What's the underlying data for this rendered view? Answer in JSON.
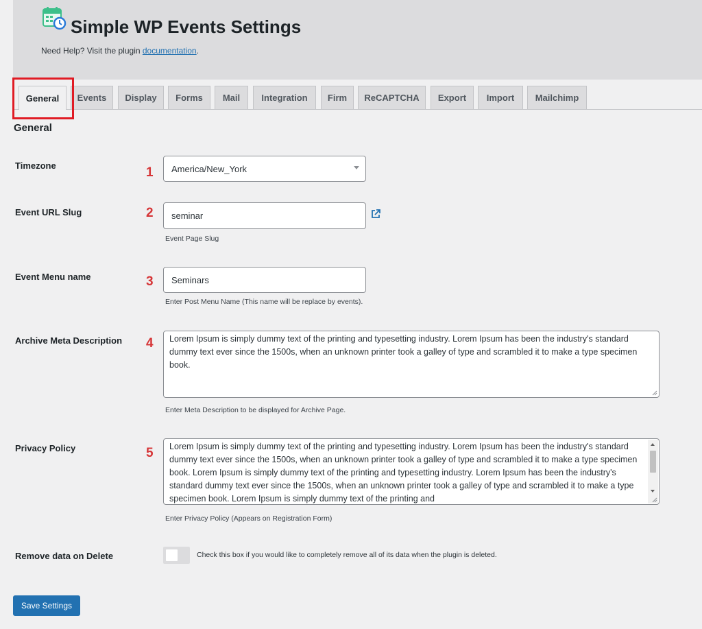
{
  "header": {
    "title": "Simple WP Events Settings",
    "help_prefix": "Need Help? Visit the plugin ",
    "help_link": "documentation",
    "help_suffix": "."
  },
  "tabs": [
    {
      "label": "General",
      "active": true
    },
    {
      "label": "Events"
    },
    {
      "label": "Display"
    },
    {
      "label": "Forms"
    },
    {
      "label": "Mail"
    },
    {
      "label": "Integration"
    },
    {
      "label": "Firm"
    },
    {
      "label": "ReCAPTCHA"
    },
    {
      "label": "Export"
    },
    {
      "label": "Import"
    },
    {
      "label": "Mailchimp"
    }
  ],
  "section_title": "General",
  "fields": {
    "timezone": {
      "label": "Timezone",
      "number": "1",
      "value": "America/New_York"
    },
    "slug": {
      "label": "Event URL Slug",
      "number": "2",
      "value": "seminar",
      "description": "Event Page Slug"
    },
    "menu_name": {
      "label": "Event Menu name",
      "number": "3",
      "value": "Seminars",
      "description": "Enter Post Menu Name (This name will be replace by events)."
    },
    "archive_meta": {
      "label": "Archive Meta Description",
      "number": "4",
      "value": "Lorem Ipsum is simply dummy text of the printing and typesetting industry. Lorem Ipsum has been the industry's standard dummy text ever since the 1500s, when an unknown printer took a galley of type and scrambled it to make a type specimen book.",
      "description": "Enter Meta Description to be displayed for Archive Page."
    },
    "privacy": {
      "label": "Privacy Policy",
      "number": "5",
      "value": "Lorem Ipsum is simply dummy text of the printing and typesetting industry. Lorem Ipsum has been the industry's standard dummy text ever since the 1500s, when an unknown printer took a galley of type and scrambled it to make a type specimen book. Lorem Ipsum is simply dummy text of the printing and typesetting industry. Lorem Ipsum has been the industry's standard dummy text ever since the 1500s, when an unknown printer took a galley of type and scrambled it to make a type specimen book. Lorem Ipsum is simply dummy text of the printing and",
      "description": "Enter Privacy Policy (Appears on Registration Form)"
    },
    "remove_data": {
      "label": "Remove data on Delete",
      "checked": false,
      "description": "Check this box if you would like to completely remove all of its data when the plugin is deleted."
    }
  },
  "save_label": "Save Settings",
  "colors": {
    "accent": "#2271b1",
    "number_red": "#d63638",
    "highlight": "#e01b24"
  },
  "icons": {
    "logo": "calendar-clock-icon",
    "external_link": "external-link-icon",
    "dropdown": "chevron-down-icon"
  }
}
